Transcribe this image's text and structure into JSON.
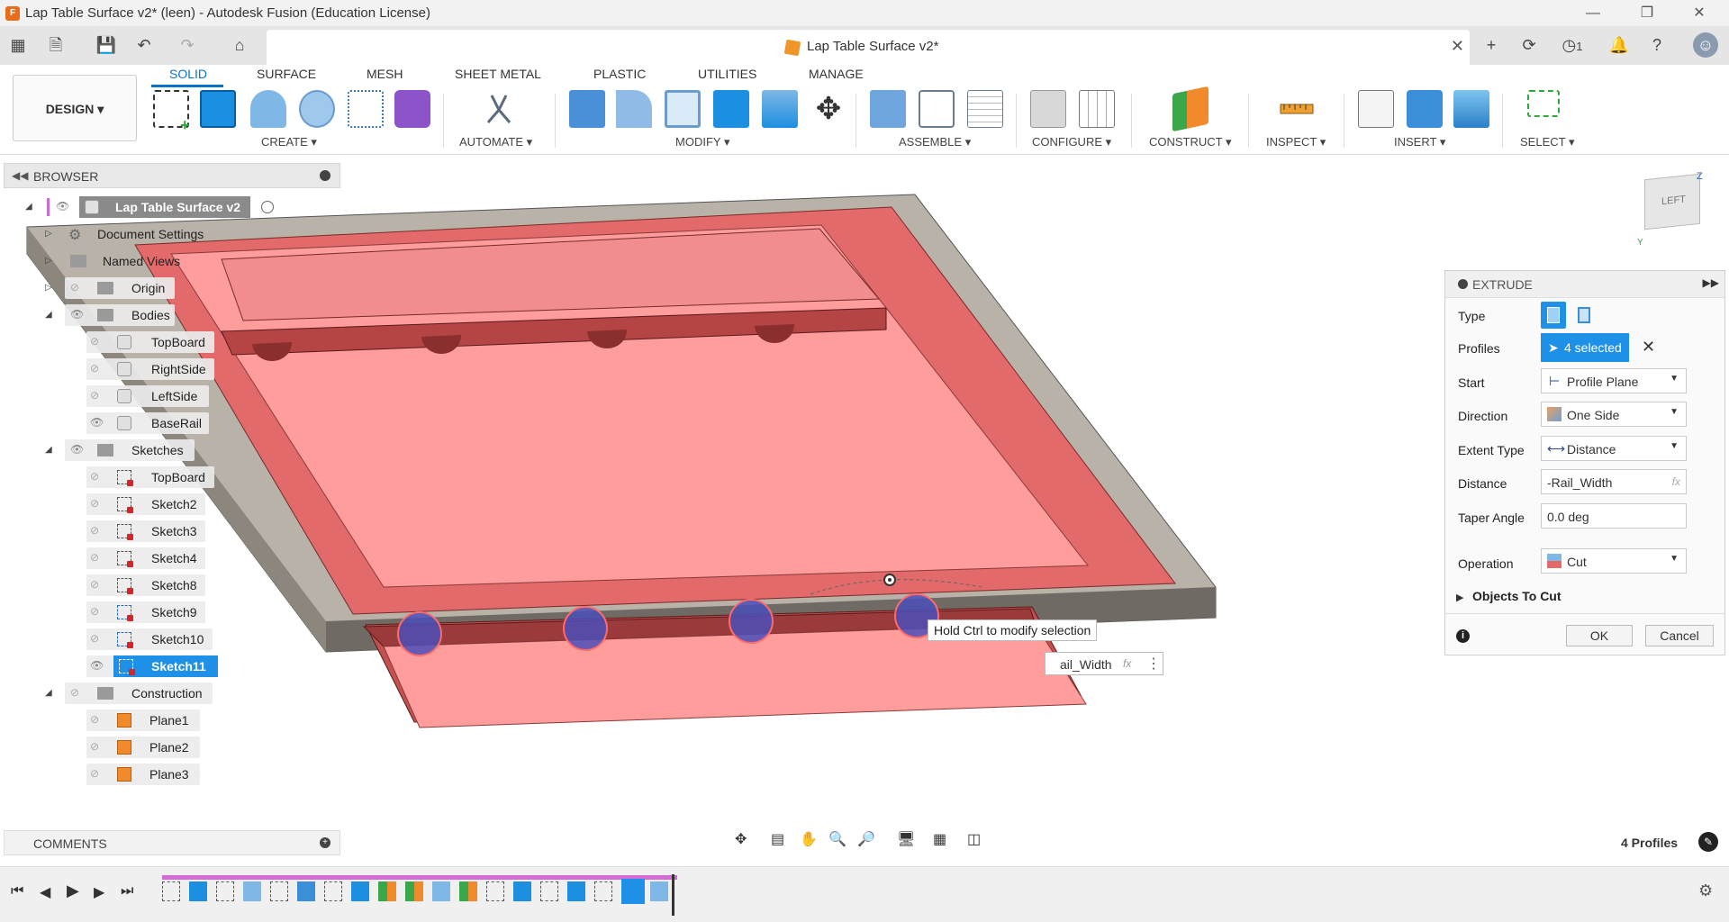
{
  "window": {
    "title": "Lap Table Surface v2* (leen) - Autodesk Fusion (Education License)",
    "app_icon_letter": "F"
  },
  "document_tab": {
    "title": "Lap Table Surface v2*",
    "jobs_count": "1"
  },
  "ribbon": {
    "workspace": "DESIGN",
    "tabs": [
      "SOLID",
      "SURFACE",
      "MESH",
      "SHEET METAL",
      "PLASTIC",
      "UTILITIES",
      "MANAGE"
    ],
    "active_tab": "SOLID",
    "groups": [
      "CREATE",
      "AUTOMATE",
      "MODIFY",
      "ASSEMBLE",
      "CONFIGURE",
      "CONSTRUCT",
      "INSPECT",
      "INSERT",
      "SELECT"
    ]
  },
  "browser": {
    "title": "BROWSER",
    "root": "Lap Table Surface v2",
    "items": [
      {
        "label": "Document Settings"
      },
      {
        "label": "Named Views"
      },
      {
        "label": "Origin"
      },
      {
        "label": "Bodies"
      },
      {
        "label": "TopBoard"
      },
      {
        "label": "RightSide"
      },
      {
        "label": "LeftSide"
      },
      {
        "label": "BaseRail"
      },
      {
        "label": "Sketches"
      },
      {
        "label": "TopBoard"
      },
      {
        "label": "Sketch2"
      },
      {
        "label": "Sketch3"
      },
      {
        "label": "Sketch4"
      },
      {
        "label": "Sketch8"
      },
      {
        "label": "Sketch9"
      },
      {
        "label": "Sketch10"
      },
      {
        "label": "Sketch11"
      },
      {
        "label": "Construction"
      },
      {
        "label": "Plane1"
      },
      {
        "label": "Plane2"
      },
      {
        "label": "Plane3"
      }
    ]
  },
  "comments": {
    "title": "COMMENTS"
  },
  "viewcube": {
    "face": "LEFT",
    "axis_z": "Z",
    "axis_y": "Y"
  },
  "extrude": {
    "title": "EXTRUDE",
    "type_label": "Type",
    "profiles_label": "Profiles",
    "profiles_value": "4 selected",
    "start_label": "Start",
    "start_value": "Profile Plane",
    "direction_label": "Direction",
    "direction_value": "One Side",
    "extent_label": "Extent Type",
    "extent_value": "Distance",
    "distance_label": "Distance",
    "distance_value": "-Rail_Width",
    "taper_label": "Taper Angle",
    "taper_value": "0.0 deg",
    "operation_label": "Operation",
    "operation_value": "Cut",
    "objects_to_cut": "Objects To Cut",
    "ok": "OK",
    "cancel": "Cancel",
    "fx": "fx"
  },
  "canvas": {
    "tooltip": "Hold Ctrl to modify selection",
    "inline_distance": "ail_Width",
    "inline_fx": "fx"
  },
  "status": {
    "profiles": "4 Profiles"
  },
  "colors": {
    "accent": "#0a74c9",
    "selection_blue": "#1e90e8",
    "body_red": "#e36a6a",
    "body_pink": "#ff9c9c",
    "frame_gray": "#b8b2a8"
  }
}
